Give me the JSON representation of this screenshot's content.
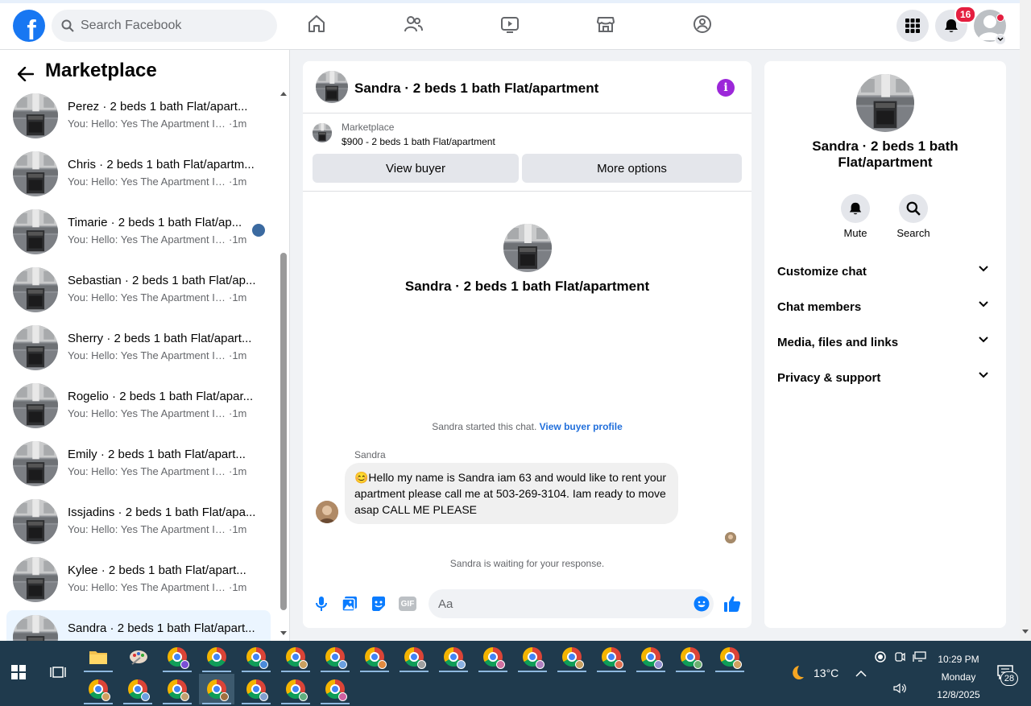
{
  "topbar": {
    "search_placeholder": "Search Facebook",
    "notifications_count": "16"
  },
  "sidebar": {
    "title": "Marketplace",
    "conversations": [
      {
        "name": "Perez · 2 beds 1 bath Flat/apart...",
        "preview": "You: Hello: Yes The Apartment Is St...",
        "time": "·1m"
      },
      {
        "name": "Chris · 2 beds 1 bath Flat/apartm...",
        "preview": "You: Hello: Yes The Apartment Is St...",
        "time": "·1m"
      },
      {
        "name": "Timarie · 2 beds 1 bath Flat/ap...",
        "preview": "You: Hello: Yes The Apartment Is...",
        "time": "·1m"
      },
      {
        "name": "Sebastian · 2 beds 1 bath Flat/ap...",
        "preview": "You: Hello: Yes The Apartment Is St...",
        "time": "·1m"
      },
      {
        "name": "Sherry · 2 beds 1 bath Flat/apart...",
        "preview": "You: Hello: Yes The Apartment Is St...",
        "time": "·1m"
      },
      {
        "name": "Rogelio · 2 beds 1 bath Flat/apar...",
        "preview": "You: Hello: Yes The Apartment Is St...",
        "time": "·1m"
      },
      {
        "name": "Emily · 2 beds 1 bath Flat/apart...",
        "preview": "You: Hello: Yes The Apartment Is St...",
        "time": "·1m"
      },
      {
        "name": "Issjadins · 2 beds 1 bath Flat/apa...",
        "preview": "You: Hello: Yes The Apartment Is St...",
        "time": "·1m"
      },
      {
        "name": "Kylee · 2 beds 1 bath Flat/apart...",
        "preview": "You: Hello: Yes The Apartment Is St...",
        "time": "·1m"
      },
      {
        "name": "Sandra · 2 beds 1 bath Flat/apart...",
        "preview": "",
        "time": ""
      }
    ]
  },
  "chat": {
    "title": "Sandra · 2 beds 1 bath Flat/apartment",
    "listing_source": "Marketplace",
    "listing_title": "$900 - 2 beds 1 bath Flat/apartment",
    "view_buyer_label": "View buyer",
    "more_options_label": "More options",
    "center_title": "Sandra · 2 beds 1 bath Flat/apartment",
    "started_text": "Sandra started this chat.",
    "started_link": "View buyer profile",
    "sender_name": "Sandra",
    "message": "😊Hello my name is Sandra iam 63 and would like to rent your apartment please call me at 503-269-3104.  Iam ready to move asap CALL ME PLEASE",
    "waiting_text": "Sandra is waiting for your response.",
    "composer_placeholder": "Aa",
    "gif_label": "GIF"
  },
  "info_panel": {
    "title": "Sandra · 2 beds 1 bath Flat/apartment",
    "mute_label": "Mute",
    "search_label": "Search",
    "sections": [
      "Customize chat",
      "Chat members",
      "Media, files and links",
      "Privacy & support"
    ]
  },
  "taskbar": {
    "temperature": "13°C",
    "time": "10:29 PM",
    "day": "Monday",
    "date": "12/8/2025",
    "notification_count": "28",
    "chrome_profile_colors_row1": [
      "#7a4fd6",
      "",
      "#4a8ad8",
      "#c8a060",
      "#6aa0e0",
      "#e08a40",
      "#a0a0a0",
      "#8ab0e0",
      "#d070a0",
      "#b080c0",
      "#c8a060",
      "#e07050",
      "#9090d0",
      "#6ab070",
      "#d0a060"
    ],
    "chrome_profile_colors_row2": [
      "#d0a060",
      "#6aa0e0",
      "#c0a070",
      "#a07040",
      "#80a0d0",
      "#60b080",
      "#d060a0"
    ]
  },
  "colors": {
    "facebook_blue": "#1877f2",
    "link_blue": "#216fdb",
    "info_purple": "#9c27d9",
    "badge_red": "#e41e3f",
    "taskbar_bg": "#1f3a4d"
  }
}
